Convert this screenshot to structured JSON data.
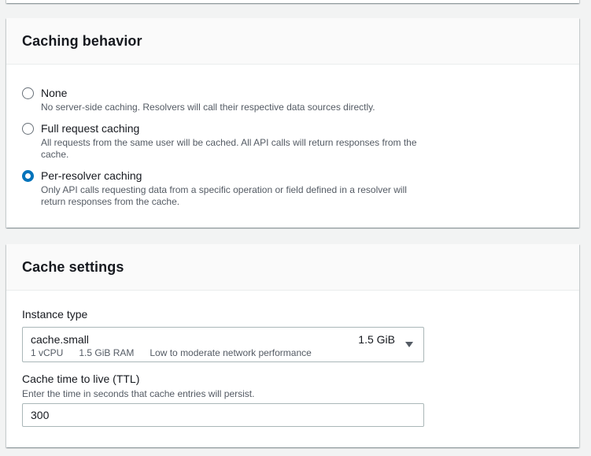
{
  "caching_behavior": {
    "title": "Caching behavior",
    "options": [
      {
        "label": "None",
        "description": "No server-side caching. Resolvers will call their respective data sources directly.",
        "selected": false
      },
      {
        "label": "Full request caching",
        "description": "All requests from the same user will be cached. All API calls will return responses from the cache.",
        "selected": false
      },
      {
        "label": "Per-resolver caching",
        "description": "Only API calls requesting data from a specific operation or field defined in a resolver will return responses from the cache.",
        "selected": true
      }
    ]
  },
  "cache_settings": {
    "title": "Cache settings",
    "instance_type": {
      "label": "Instance type",
      "selected_name": "cache.small",
      "selected_size": "1.5 GiB",
      "tags": [
        "1 vCPU",
        "1.5 GiB RAM",
        "Low to moderate network performance"
      ]
    },
    "ttl": {
      "label": "Cache time to live (TTL)",
      "description": "Enter the time in seconds that cache entries will persist.",
      "value": "300"
    }
  },
  "colors": {
    "accent": "#0073bb",
    "header_bg": "#fafafa",
    "page_bg": "#f2f3f3"
  }
}
